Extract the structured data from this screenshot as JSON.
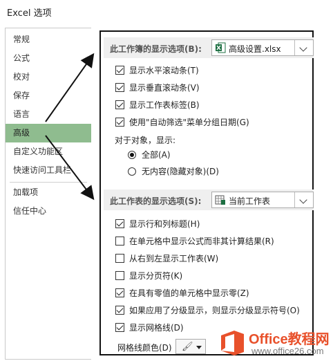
{
  "window": {
    "title": "Excel 选项"
  },
  "sidebar": {
    "items": [
      {
        "label": "常规"
      },
      {
        "label": "公式"
      },
      {
        "label": "校对"
      },
      {
        "label": "保存"
      },
      {
        "label": "语言"
      },
      {
        "label": "高级",
        "selected": true
      },
      {
        "label": "自定义功能区"
      },
      {
        "label": "快速访问工具栏"
      },
      {
        "label": "加载项"
      },
      {
        "label": "信任中心"
      }
    ]
  },
  "workbook_section": {
    "heading": "此工作簿的显示选项(B):",
    "selected_workbook": "高级设置.xlsx",
    "options": [
      {
        "label": "显示水平滚动条(T)",
        "checked": true
      },
      {
        "label": "显示垂直滚动条(V)",
        "checked": true
      },
      {
        "label": "显示工作表标签(B)",
        "checked": true
      },
      {
        "label": "使用\"自动筛选\"菜单分组日期(G)",
        "checked": true
      }
    ],
    "objects_label": "对于对象，显示:",
    "object_options": [
      {
        "label": "全部(A)",
        "selected": true
      },
      {
        "label": "无内容(隐藏对象)(D)",
        "selected": false
      }
    ]
  },
  "worksheet_section": {
    "heading": "此工作表的显示选项(S):",
    "selected_sheet": "当前工作表",
    "options": [
      {
        "label": "显示行和列标题(H)",
        "checked": true
      },
      {
        "label": "在单元格中显示公式而非其计算结果(R)",
        "checked": false
      },
      {
        "label": "从右到左显示工作表(W)",
        "checked": false
      },
      {
        "label": "显示分页符(K)",
        "checked": false
      },
      {
        "label": "在具有零值的单元格中显示零(Z)",
        "checked": true
      },
      {
        "label": "如果应用了分级显示，则显示分级显示符号(O)",
        "checked": true
      },
      {
        "label": "显示网格线(D)",
        "checked": true
      }
    ],
    "gridline_color_label": "网格线颜色(D)"
  },
  "watermark": {
    "brand": "Office教程网",
    "site": "www.office26.com"
  },
  "colors": {
    "selected_item": "#8fbc8f",
    "excel_green": "#1d6f42",
    "brand_orange": "#e8512b"
  },
  "icons": [
    "excel-file-icon",
    "sheet-icon",
    "paint-bucket-icon",
    "chevron-down-icon"
  ]
}
